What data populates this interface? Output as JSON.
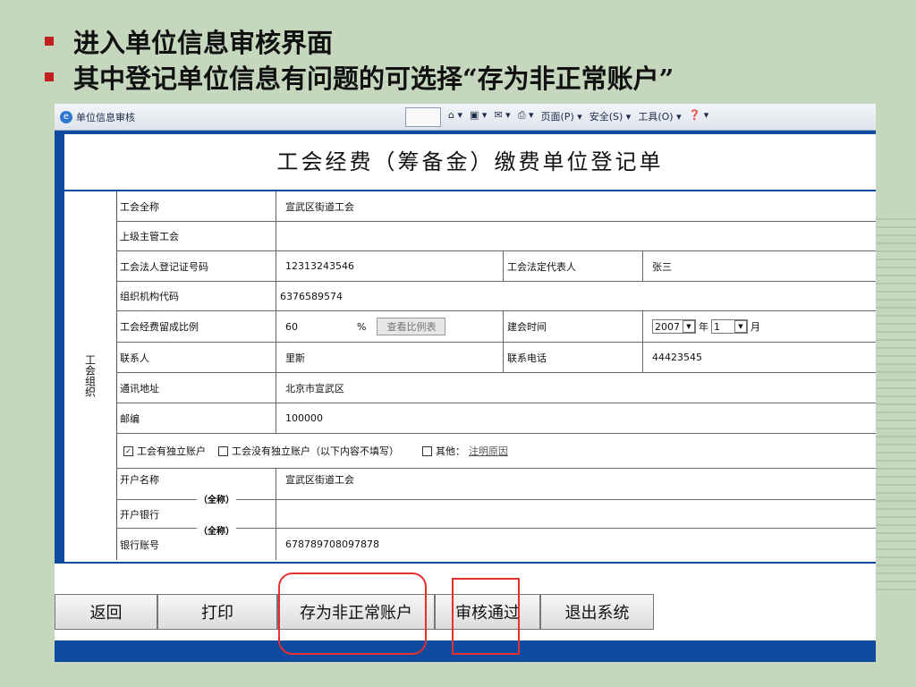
{
  "bullets": [
    "进入单位信息审核界面",
    "其中登记单位信息有问题的可选择“存为非正常账户”"
  ],
  "browser": {
    "tab_title": "单位信息审核",
    "tools": [
      "页面(P) ▾",
      "安全(S) ▾",
      "工具(O) ▾"
    ]
  },
  "form": {
    "title": "工会经费（筹备金）缴费单位登记单",
    "side_label": "工会组织",
    "full_name_label": "工会全称",
    "full_name_value": "宣武区街道工会",
    "superior_label": "上级主管工会",
    "reg_no_label": "工会法人登记证号码",
    "reg_no_value": "12313243546",
    "rep_label": "工会法定代表人",
    "rep_value": "张三",
    "org_code_label": "组织机构代码",
    "org_code_value": "6376589574",
    "ratio_label": "工会经费留成比例",
    "ratio_value": "60",
    "ratio_unit": "%",
    "ratio_button": "查看比例表",
    "founded_label": "建会时间",
    "year_value": "2007",
    "year_unit": "年",
    "month_value": "1",
    "month_unit": "月",
    "contact_label": "联系人",
    "contact_value": "里斯",
    "phone_label": "联系电话",
    "phone_value": "44423545",
    "address_label": "通讯地址",
    "address_value": "北京市宣武区",
    "postcode_label": "邮编",
    "postcode_value": "100000",
    "opt_independent": "工会有独立账户",
    "opt_none": "工会没有独立账户（以下内容不填写）",
    "opt_other": "其他：",
    "opt_other_link": "注明原因",
    "account_name_label": "开户名称",
    "account_name_value": "宣武区街道工会",
    "full_tag": "（全称）",
    "bank_label": "开户银行",
    "account_no_label": "银行账号",
    "account_no_value": "678789708097878"
  },
  "buttons": {
    "back": "返回",
    "print": "打印",
    "abnormal": "存为非正常账户",
    "approve": "审核通过",
    "exit": "退出系统"
  }
}
